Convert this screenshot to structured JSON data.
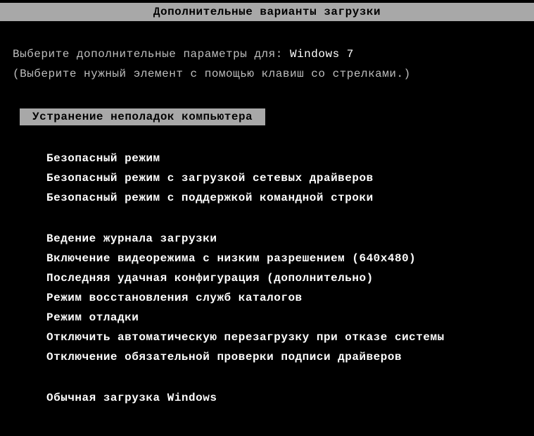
{
  "title": "Дополнительные варианты загрузки",
  "prompt": {
    "prefix": "Выберите дополнительные параметры для: ",
    "os": "Windows 7"
  },
  "hint": "(Выберите нужный элемент с помощью клавиш со стрелками.)",
  "selected": "Устранение неполадок компьютера",
  "group1": {
    "item1": "Безопасный режим",
    "item2": "Безопасный режим с загрузкой сетевых драйверов",
    "item3": "Безопасный режим с поддержкой командной строки"
  },
  "group2": {
    "item1": "Ведение журнала загрузки",
    "item2": "Включение видеорежима с низким разрешением (640x480)",
    "item3": "Последняя удачная конфигурация (дополнительно)",
    "item4": "Режим восстановления служб каталогов",
    "item5": "Режим отладки",
    "item6": "Отключить автоматическую перезагрузку при отказе системы",
    "item7": "Отключение обязательной проверки подписи драйверов"
  },
  "group3": {
    "item1": "Обычная загрузка Windows"
  }
}
